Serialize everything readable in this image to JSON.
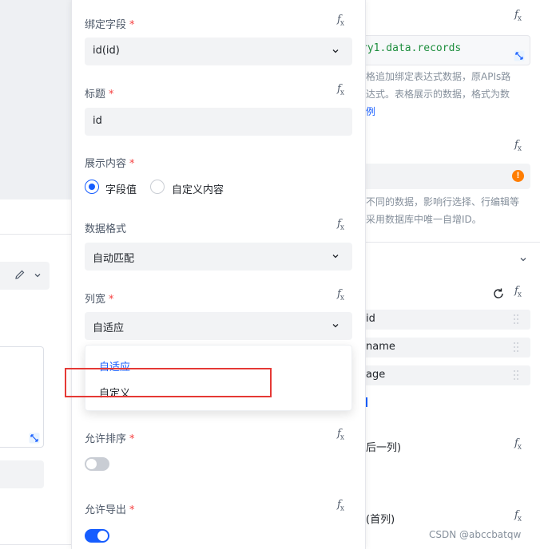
{
  "right_panel": {
    "code_value": "ry1.data.records",
    "desc_line1": "格追加绑定表达式数据，原APIs路",
    "desc_line2": "达式。表格展示的数据，格式为数",
    "desc_link": "例",
    "primary_desc_line1": "不同的数据，影响行选择、行编辑等",
    "primary_desc_line2": "采用数据库中唯一自增ID。",
    "warning_glyph": "!",
    "fields": [
      "id",
      "name",
      "age"
    ],
    "fixed_right_label": "后一列)",
    "fixed_left_label": "(首列)"
  },
  "panel": {
    "bind_field": {
      "label": "绑定字段",
      "value": "id(id)"
    },
    "title": {
      "label": "标题",
      "value": "id"
    },
    "display": {
      "label": "展示内容",
      "options": [
        "字段值",
        "自定义内容"
      ],
      "selected": "字段值"
    },
    "data_format": {
      "label": "数据格式",
      "value": "自动匹配"
    },
    "col_width": {
      "label": "列宽",
      "value": "自适应",
      "options": [
        "自适应",
        "自定义"
      ]
    },
    "allow_sort": {
      "label": "允许排序",
      "on": false
    },
    "allow_export": {
      "label": "允许导出",
      "on": true
    },
    "required_mark": "*",
    "fx_label": "f",
    "fx_sub": "x"
  },
  "watermark": "CSDN @abccbatqw",
  "colors": {
    "accent": "#165dff",
    "required": "#f53f3f",
    "highlight": "#e53935",
    "warning": "#ff7d00",
    "code": "#1e8e3e"
  }
}
